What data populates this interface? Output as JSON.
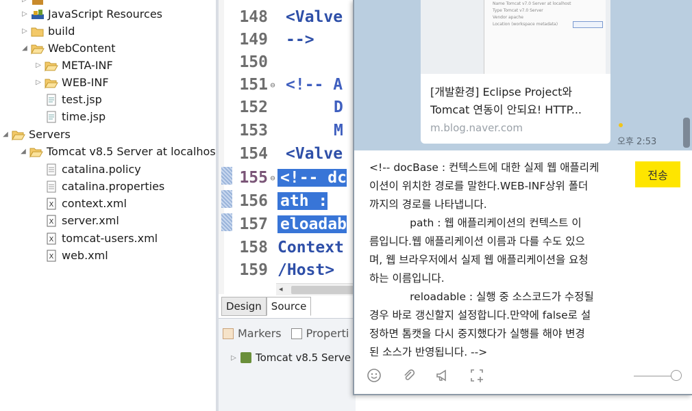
{
  "explorer": {
    "items": [
      {
        "label": "JavaScript Resources",
        "icon": "javascript-resources-icon",
        "expanded": false
      },
      {
        "label": "build",
        "icon": "folder-icon",
        "expanded": false
      },
      {
        "label": "WebContent",
        "icon": "folder-open-icon",
        "expanded": true
      },
      {
        "label": "META-INF",
        "icon": "folder-icon",
        "expanded": false
      },
      {
        "label": "WEB-INF",
        "icon": "folder-icon",
        "expanded": false
      },
      {
        "label": "test.jsp",
        "icon": "jsp-file-icon"
      },
      {
        "label": "time.jsp",
        "icon": "jsp-file-icon"
      },
      {
        "label": "Servers",
        "icon": "folder-open-icon",
        "expanded": true
      },
      {
        "label": "Tomcat v8.5 Server at localhos",
        "icon": "folder-open-icon",
        "expanded": true
      },
      {
        "label": "catalina.policy",
        "icon": "text-file-icon"
      },
      {
        "label": "catalina.properties",
        "icon": "text-file-icon"
      },
      {
        "label": "context.xml",
        "icon": "xml-file-icon"
      },
      {
        "label": "server.xml",
        "icon": "xml-file-icon"
      },
      {
        "label": "tomcat-users.xml",
        "icon": "xml-file-icon"
      },
      {
        "label": "web.xml",
        "icon": "xml-file-icon"
      }
    ]
  },
  "editor": {
    "lines": [
      {
        "num": "148",
        "text": "<Valve"
      },
      {
        "num": "149",
        "text": "-->"
      },
      {
        "num": "150",
        "text": ""
      },
      {
        "num": "151",
        "text": "<!-- A",
        "fold": "⊖"
      },
      {
        "num": "152",
        "text": "D"
      },
      {
        "num": "153",
        "text": "M"
      },
      {
        "num": "154",
        "text": "<Valve"
      },
      {
        "num": "155",
        "text": "<!-- dc",
        "fold": "⊖",
        "selected": true
      },
      {
        "num": "156",
        "text": "ath : ",
        "selected": true
      },
      {
        "num": "157",
        "text": "eloadab",
        "selected": true
      },
      {
        "num": "158",
        "text": "Context"
      },
      {
        "num": "159",
        "text": "/Host>"
      }
    ],
    "tabs": {
      "design": "Design",
      "source": "Source"
    }
  },
  "bottom_panel": {
    "tabs": {
      "markers": "Markers",
      "properties": "Properti"
    },
    "server_entry": "Tomcat v8.5 Serve"
  },
  "chat": {
    "link_card": {
      "title_line1": "[개발환경] Eclipse Project와",
      "title_line2": "Tomcat 연동이 안되요! HTTP...",
      "domain": "m.blog.naver.com",
      "thumb_rows": {
        "r1": "Name    Tomcat v7.0 Server at localhost",
        "r2": "Type    Tomcat v7.0 Server",
        "r3": "Vendor  apache",
        "r4": "Location  (workspace metadata)"
      }
    },
    "time": "오후 2:53",
    "message_lines": [
      "<!-- docBase : 컨텍스트에 대한 실제 웹 애플리케",
      "이션이 위치한 경로를 말한다.WEB-INF상위 폴더",
      "까지의 경로를 나타냅니다.",
      "            path : 웹 애플리케이션의 컨텍스트 이",
      "름입니다.웹 애플리케이션 이름과 다를 수도 있으",
      "며, 웹 브라우저에서 실제 웹 애플리케이션을 요청",
      "하는 이름입니다.",
      "            reloadable : 실행 중 소스코드가 수정될",
      "경우 바로 갱신할지 설정합니다.만약에 false로 설",
      "정하면 톰캣을 다시 중지했다가 실행를 해야 변경",
      "된 소스가 반영됩니다. -->"
    ],
    "send_label": "전송",
    "tools": [
      "emoticon-icon",
      "attach-icon",
      "shout-icon",
      "capture-icon"
    ]
  },
  "colors": {
    "selection": "#3875d7",
    "chat_bg": "#bacee0",
    "send_button": "#fee500"
  }
}
